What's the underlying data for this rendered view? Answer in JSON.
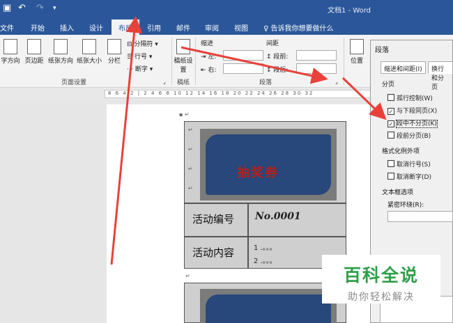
{
  "titlebar": {
    "doc_title": "文档1 - Word"
  },
  "tabs": [
    {
      "label": "文件"
    },
    {
      "label": "开始"
    },
    {
      "label": "插入"
    },
    {
      "label": "设计"
    },
    {
      "label": "布局"
    },
    {
      "label": "引用"
    },
    {
      "label": "邮件"
    },
    {
      "label": "审阅"
    },
    {
      "label": "视图"
    }
  ],
  "tell_me": "告诉我你想要做什么",
  "ribbon": {
    "buttons": {
      "text_direction": "字方向",
      "margins": "页边距",
      "orientation": "纸张方向",
      "size": "纸张大小",
      "columns": "分栏",
      "breaks": "分隔符",
      "line_numbers": "行号",
      "hyphenation": "断字",
      "draft": "稿纸设置",
      "position": "位置"
    },
    "groups": {
      "page_setup": "页面设置",
      "draft": "稿纸",
      "paragraph": "段落"
    },
    "indent": {
      "header": "缩进",
      "left": "左:",
      "right": "右:"
    },
    "spacing": {
      "header": "间距",
      "before": "段前:",
      "after": "段后:"
    }
  },
  "document": {
    "ticket_title": "抽奖券",
    "rows": [
      {
        "label": "活动编号",
        "value": "No.0001"
      },
      {
        "label": "活动内容",
        "items": [
          "1 .。。。",
          "2 .。。。"
        ]
      }
    ]
  },
  "dialog": {
    "title": "段落",
    "tabs": [
      "缩进和间距(I)",
      "换行和分页"
    ],
    "sections": {
      "pagination": "分页",
      "format_exceptions": "格式化例外项",
      "textbox": "文本框选项",
      "tight_wrap": "紧密环绕(R):"
    },
    "checkboxes": [
      {
        "label": "孤行控制(W)",
        "checked": false
      },
      {
        "label": "与下段同页(X)",
        "checked": true
      },
      {
        "label": "段中不分页(K)",
        "checked": true
      },
      {
        "label": "段前分页(B)",
        "checked": false
      },
      {
        "label": "取消行号(S)",
        "checked": false
      },
      {
        "label": "取消断字(D)",
        "checked": false
      }
    ]
  },
  "watermark": {
    "title": "百科全说",
    "subtitle": "助你轻松解决"
  },
  "colors": {
    "accent": "#2b579a",
    "arrow": "#e8413a",
    "brand_green": "#2e9f4a",
    "ticket_blue": "#28477a",
    "ticket_title": "#b51f1f"
  }
}
